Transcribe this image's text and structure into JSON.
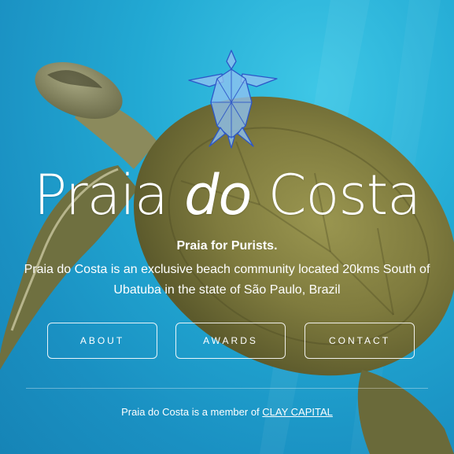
{
  "hero": {
    "title_part1": "Praia ",
    "title_part2": "do",
    "title_part3": " Costa",
    "tagline": "Praia for Purists.",
    "description": "Praia do Costa is an exclusive beach community located 20kms South of Ubatuba in the state of São Paulo, Brazil"
  },
  "nav": {
    "about": "ABOUT",
    "awards": "AWARDS",
    "contact": "CONTACT"
  },
  "footer": {
    "text": "Praia do Costa is a member of ",
    "link": "CLAY CAPITAL"
  },
  "colors": {
    "water": "#22a9d3",
    "logo_fill": "#8fc2f0",
    "logo_stroke": "#2d57c8",
    "shell": "#7d7a3e"
  },
  "icons": {
    "logo": "turtle-logo-icon",
    "background": "sea-turtle-photo"
  }
}
